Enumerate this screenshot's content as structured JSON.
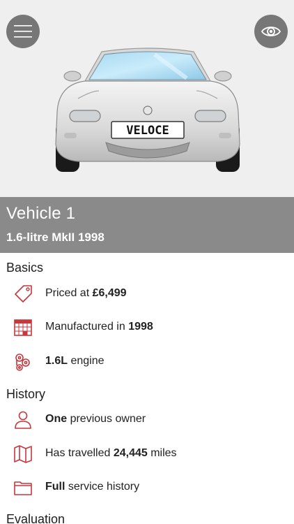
{
  "header": {
    "menu_icon": "hamburger-menu-icon",
    "view_icon": "eye-icon",
    "number_plate": "VELOCE"
  },
  "vehicle": {
    "name": "Vehicle 1",
    "subtitle": "1.6-litre MkII 1998"
  },
  "sections": {
    "basics": {
      "title": "Basics",
      "items": [
        {
          "icon": "price-tag-icon",
          "prefix": "Priced at ",
          "bold": "£6,499",
          "suffix": ""
        },
        {
          "icon": "calendar-icon",
          "prefix": "Manufactured in ",
          "bold": "1998",
          "suffix": ""
        },
        {
          "icon": "engine-icon",
          "prefix": "",
          "bold": "1.6L",
          "suffix": " engine"
        }
      ]
    },
    "history": {
      "title": "History",
      "items": [
        {
          "icon": "person-icon",
          "prefix": "",
          "bold": "One",
          "suffix": " previous owner"
        },
        {
          "icon": "map-icon",
          "prefix": "Has travelled ",
          "bold": "24,445",
          "suffix": " miles"
        },
        {
          "icon": "folder-icon",
          "prefix": "",
          "bold": "Full",
          "suffix": " service history"
        }
      ]
    },
    "evaluation": {
      "title": "Evaluation"
    }
  },
  "colors": {
    "accent": "#c8373c",
    "title_band": "#8a8a8a",
    "hero_bg": "#efefef",
    "button_bg": "#777777"
  }
}
